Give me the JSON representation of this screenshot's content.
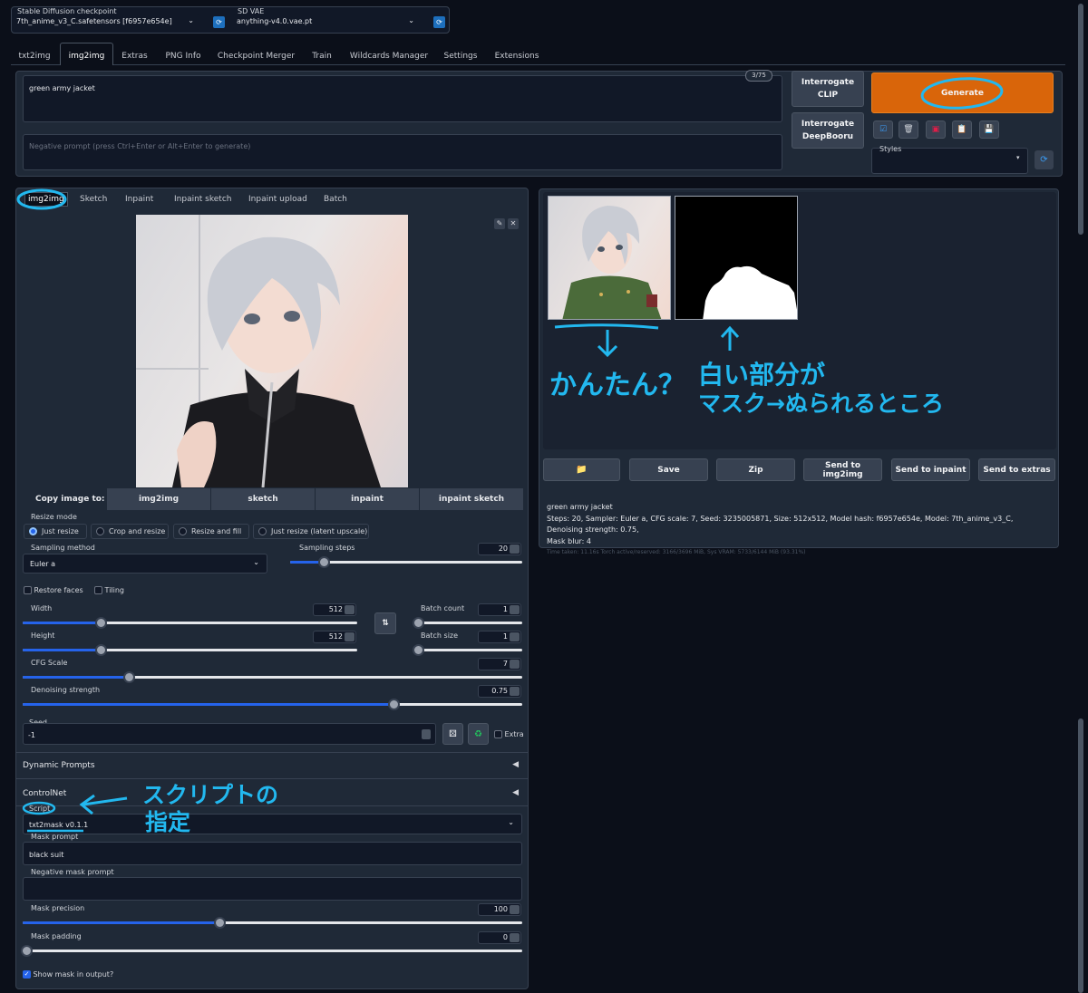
{
  "checkpoint": {
    "label": "Stable Diffusion checkpoint",
    "value": "7th_anime_v3_C.safetensors [f6957e654e]"
  },
  "vae": {
    "label": "SD VAE",
    "value": "anything-v4.0.vae.pt"
  },
  "tabs": [
    "txt2img",
    "img2img",
    "Extras",
    "PNG Info",
    "Checkpoint Merger",
    "Train",
    "Wildcards Manager",
    "Settings",
    "Extensions"
  ],
  "prompt": {
    "value": "green army jacket",
    "token_count": "3/75",
    "negative_placeholder": "Negative prompt (press Ctrl+Enter or Alt+Enter to generate)"
  },
  "buttons": {
    "interrogate_clip": "Interrogate CLIP",
    "interrogate_deepbooru": "Interrogate DeepBooru",
    "generate": "Generate"
  },
  "styles": {
    "label": "Styles"
  },
  "subtabs": [
    "img2img",
    "Sketch",
    "Inpaint",
    "Inpaint sketch",
    "Inpaint upload",
    "Batch"
  ],
  "copy_image": {
    "label": "Copy image to:",
    "targets": [
      "img2img",
      "sketch",
      "inpaint",
      "inpaint sketch"
    ]
  },
  "resize": {
    "label": "Resize mode",
    "options": [
      "Just resize",
      "Crop and resize",
      "Resize and fill",
      "Just resize (latent upscale)"
    ],
    "selected": 0
  },
  "sampling": {
    "method_label": "Sampling method",
    "method": "Euler a",
    "steps_label": "Sampling steps",
    "steps": 20
  },
  "checks": {
    "restore_faces": "Restore faces",
    "tiling": "Tiling"
  },
  "params": {
    "width_label": "Width",
    "width": 512,
    "height_label": "Height",
    "height": 512,
    "batch_count_label": "Batch count",
    "batch_count": 1,
    "batch_size_label": "Batch size",
    "batch_size": 1,
    "cfg_label": "CFG Scale",
    "cfg": 7,
    "denoise_label": "Denoising strength",
    "denoise": 0.75,
    "seed_label": "Seed",
    "seed": "-1",
    "extra_label": "Extra"
  },
  "sections": {
    "dynamic_prompts": "Dynamic Prompts",
    "controlnet": "ControlNet"
  },
  "script": {
    "label": "Script",
    "value": "txt2mask v0.1.1",
    "mask_prompt_label": "Mask prompt",
    "mask_prompt": "black suit",
    "neg_mask_label": "Negative mask prompt",
    "precision_label": "Mask precision",
    "precision": 100,
    "padding_label": "Mask padding",
    "padding": 0,
    "show_mask_label": "Show mask in output?"
  },
  "output_buttons": [
    "Save",
    "Zip",
    "Send to img2img",
    "Send to inpaint",
    "Send to extras"
  ],
  "info": {
    "prompt": "green army jacket",
    "params": "Steps: 20, Sampler: Euler a, CFG scale: 7, Seed: 3235005871, Size: 512x512, Model hash: f6957e654e, Model: 7th_anime_v3_C, Denoising strength: 0.75,",
    "mask_blur": "Mask blur: 4",
    "time": "Time taken: 11.16s  Torch active/reserved: 3166/3696 MiB, Sys VRAM: 5733/6144 MiB (93.31%)"
  },
  "annotations": {
    "easy": "かんたん？",
    "mask_line1": "白い部分が",
    "mask_line2": "マスク→ぬられるところ",
    "script_line1": "スクリプトの",
    "script_line2": "指定"
  },
  "colors": {
    "generate": "#d9650a",
    "accent": "#2563eb",
    "annotation": "#22b8ef"
  }
}
